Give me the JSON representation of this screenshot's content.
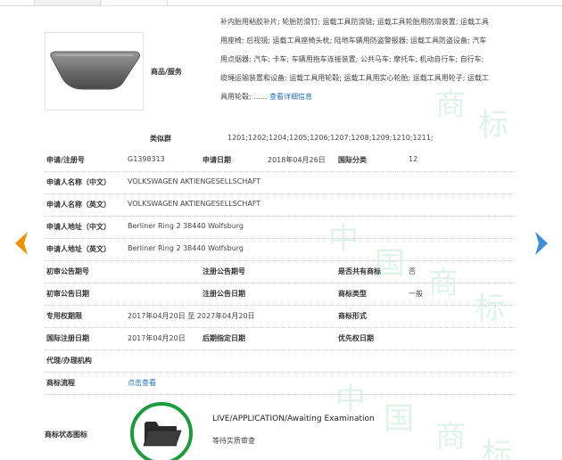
{
  "goods": {
    "label": "商品/服务",
    "lines": [
      "补内胎用粘胶补片; 轮胎防滑钉; 运载工具防滑链; 运载工具轮胎用防滑装置; 运载工具",
      "用座椅; 后视镜; 运载工具座椅头枕; 陆地车辆用防盗警报器; 运载工具防盗设备; 汽车",
      "用点烟器; 汽车; 卡车; 车辆用拖车连接装置; 公共马车; 摩托车; 机动自行车; 自行车;",
      "缆绳运输装置和设备; 运载工具用轮毂; 运载工具用实心轮胎; 运载工具用轮子; 运载工",
      "具用轮毂; ......"
    ],
    "more_link": "查看详细信息"
  },
  "similar_groups": {
    "label": "类似群",
    "value": "1201;1202;1204;1205;1206;1207;1208;1209;1210;1211;"
  },
  "fields": {
    "reg_no_label": "申请/注册号",
    "reg_no": "G1398313",
    "app_date_label": "申请日期",
    "app_date": "2018年04月26日",
    "intl_class_label": "国际分类",
    "intl_class": "12",
    "applicant_cn_label": "申请人名称（中文）",
    "applicant_cn": "VOLKSWAGEN AKTIENGESELLSCHAFT",
    "applicant_en_label": "申请人名称（英文）",
    "applicant_en": "VOLKSWAGEN AKTIENGESELLSCHAFT",
    "address_cn_label": "申请人地址（中文）",
    "address_cn": "Berliner Ring 2 38440 Wolfsburg",
    "address_en_label": "申请人地址（英文）",
    "address_en": "Berliner Ring 2 38440 Wolfsburg",
    "prelim_pub_no_label": "初审公告期号",
    "reg_pub_no_label": "注册公告期号",
    "shared_label": "是否共有商标",
    "shared": "否",
    "prelim_pub_date_label": "初审公告日期",
    "reg_pub_date_label": "注册公告日期",
    "mark_type_label": "商标类型",
    "mark_type": "一般",
    "exclusive_period_label": "专用权期限",
    "exclusive_period": "2017年04月20日 至 2027年04月20日",
    "mark_form_label": "商标形式",
    "intl_reg_date_label": "国际注册日期",
    "intl_reg_date": "2017年04月20日",
    "later_designation_label": "后期指定日期",
    "priority_date_label": "优先权日期",
    "agent_label": "代理/办理机构",
    "process_label": "商标流程",
    "process_link": "点击查看",
    "status_icon_label": "商标状态图标"
  },
  "status": {
    "en": "LIVE/APPLICATION/Awaiting Examination",
    "cn": "等待实质审查",
    "icon": "folder-icon",
    "ring_color": "#1a9c3c"
  },
  "nav": {
    "prev_icon": "arrow-left-icon",
    "next_icon": "arrow-right-icon",
    "prev_color": "#f29100",
    "next_color": "#3b8fd6"
  },
  "watermark": [
    "中",
    "国",
    "商",
    "标"
  ]
}
